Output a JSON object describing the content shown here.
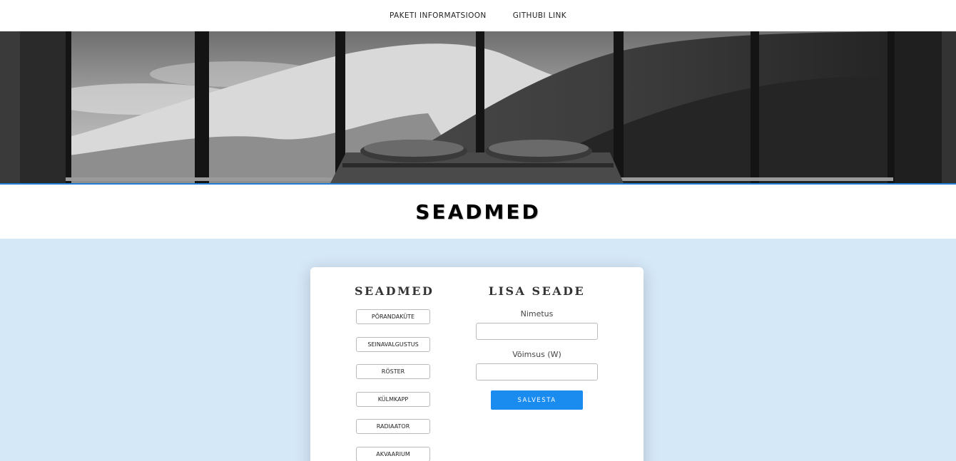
{
  "nav": {
    "items": [
      {
        "label": "PAKETI INFORMATSIOON"
      },
      {
        "label": "GITHUBI LINK"
      }
    ]
  },
  "hero": {
    "image": "bedroom-mountain-view-photo"
  },
  "section": {
    "title": "SEADMED"
  },
  "devices_panel": {
    "heading": "SEADMED",
    "items": [
      {
        "label": "PÕRANDAKÜTE"
      },
      {
        "label": "SEINAVALGUSTUS"
      },
      {
        "label": "RÖSTER"
      },
      {
        "label": "KÜLMKAPP"
      },
      {
        "label": "RADIAATOR"
      },
      {
        "label": "AKVAARIUM"
      }
    ]
  },
  "add_panel": {
    "heading": "LISA SEADE",
    "name_label": "Nimetus",
    "name_value": "",
    "power_label": "Võimsus (W)",
    "power_value": "",
    "save_label": "SALVESTA"
  },
  "colors": {
    "accent": "#1a8cef",
    "background_blue": "#d5e8f8",
    "hero_border": "#1e7fd1"
  }
}
